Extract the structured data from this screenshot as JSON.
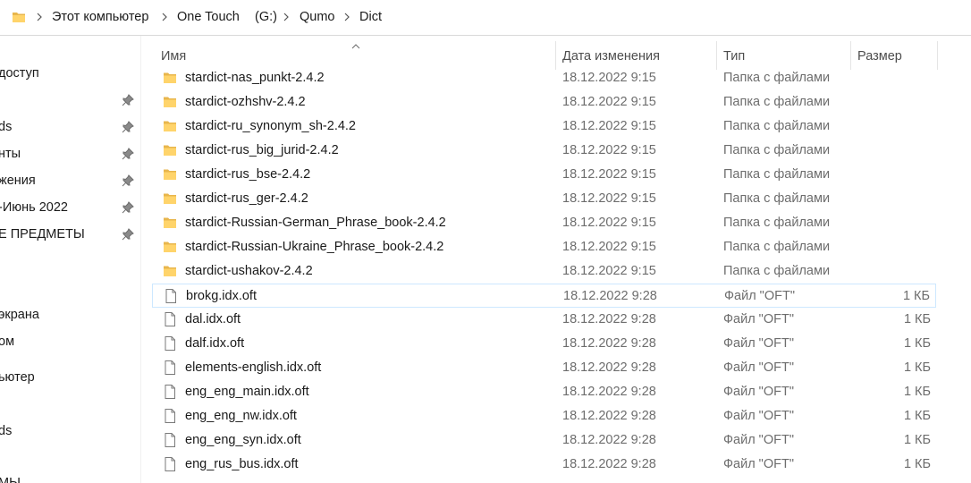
{
  "address": {
    "crumbs": [
      "Этот компьютер",
      "One Touch",
      "(G:)",
      "Qumo",
      "Dict"
    ]
  },
  "nav": {
    "items": [
      {
        "label": "доступ",
        "pinned": false
      },
      {
        "label": "",
        "pinned": true
      },
      {
        "label": "ds",
        "pinned": true
      },
      {
        "label": "нты",
        "pinned": true
      },
      {
        "label": "жения",
        "pinned": true
      },
      {
        "label": "-Июнь 2022",
        "pinned": true
      },
      {
        "label": "Е ПРЕДМЕТЫ",
        "pinned": true
      },
      {
        "label": "экрана",
        "pinned": false
      },
      {
        "label": "ом",
        "pinned": false
      },
      {
        "label": "ьютер",
        "pinned": false
      },
      {
        "label": "ds",
        "pinned": false
      },
      {
        "label": "МЫ",
        "pinned": false
      }
    ]
  },
  "columns": {
    "name": "Имя",
    "date": "Дата изменения",
    "type": "Тип",
    "size": "Размер"
  },
  "files": [
    {
      "name": "stardict-nas_punkt-2.4.2",
      "date": "18.12.2022 9:15",
      "type": "Папка с файлами",
      "size": "",
      "kind": "folder-icon"
    },
    {
      "name": "stardict-ozhshv-2.4.2",
      "date": "18.12.2022 9:15",
      "type": "Папка с файлами",
      "size": "",
      "kind": "folder-icon"
    },
    {
      "name": "stardict-ru_synonym_sh-2.4.2",
      "date": "18.12.2022 9:15",
      "type": "Папка с файлами",
      "size": "",
      "kind": "folder-icon"
    },
    {
      "name": "stardict-rus_big_jurid-2.4.2",
      "date": "18.12.2022 9:15",
      "type": "Папка с файлами",
      "size": "",
      "kind": "folder-icon"
    },
    {
      "name": "stardict-rus_bse-2.4.2",
      "date": "18.12.2022 9:15",
      "type": "Папка с файлами",
      "size": "",
      "kind": "folder-icon"
    },
    {
      "name": "stardict-rus_ger-2.4.2",
      "date": "18.12.2022 9:15",
      "type": "Папка с файлами",
      "size": "",
      "kind": "folder-icon"
    },
    {
      "name": "stardict-Russian-German_Phrase_book-2.4.2",
      "date": "18.12.2022 9:15",
      "type": "Папка с файлами",
      "size": "",
      "kind": "folder-icon"
    },
    {
      "name": "stardict-Russian-Ukraine_Phrase_book-2.4.2",
      "date": "18.12.2022 9:15",
      "type": "Папка с файлами",
      "size": "",
      "kind": "folder-icon"
    },
    {
      "name": "stardict-ushakov-2.4.2",
      "date": "18.12.2022 9:15",
      "type": "Папка с файлами",
      "size": "",
      "kind": "folder-icon"
    },
    {
      "name": "brokg.idx.oft",
      "date": "18.12.2022 9:28",
      "type": "Файл \"OFT\"",
      "size": "1 КБ",
      "kind": "file-icon",
      "focused": true
    },
    {
      "name": "dal.idx.oft",
      "date": "18.12.2022 9:28",
      "type": "Файл \"OFT\"",
      "size": "1 КБ",
      "kind": "file-icon"
    },
    {
      "name": "dalf.idx.oft",
      "date": "18.12.2022 9:28",
      "type": "Файл \"OFT\"",
      "size": "1 КБ",
      "kind": "file-icon"
    },
    {
      "name": "elements-english.idx.oft",
      "date": "18.12.2022 9:28",
      "type": "Файл \"OFT\"",
      "size": "1 КБ",
      "kind": "file-icon"
    },
    {
      "name": "eng_eng_main.idx.oft",
      "date": "18.12.2022 9:28",
      "type": "Файл \"OFT\"",
      "size": "1 КБ",
      "kind": "file-icon"
    },
    {
      "name": "eng_eng_nw.idx.oft",
      "date": "18.12.2022 9:28",
      "type": "Файл \"OFT\"",
      "size": "1 КБ",
      "kind": "file-icon"
    },
    {
      "name": "eng_eng_syn.idx.oft",
      "date": "18.12.2022 9:28",
      "type": "Файл \"OFT\"",
      "size": "1 КБ",
      "kind": "file-icon"
    },
    {
      "name": "eng_rus_bus.idx.oft",
      "date": "18.12.2022 9:28",
      "type": "Файл \"OFT\"",
      "size": "1 КБ",
      "kind": "file-icon"
    }
  ],
  "colors": {
    "folder": "#e8b64c",
    "folderFront": "#ffd46b",
    "focusOutline": "#cde8ff"
  }
}
